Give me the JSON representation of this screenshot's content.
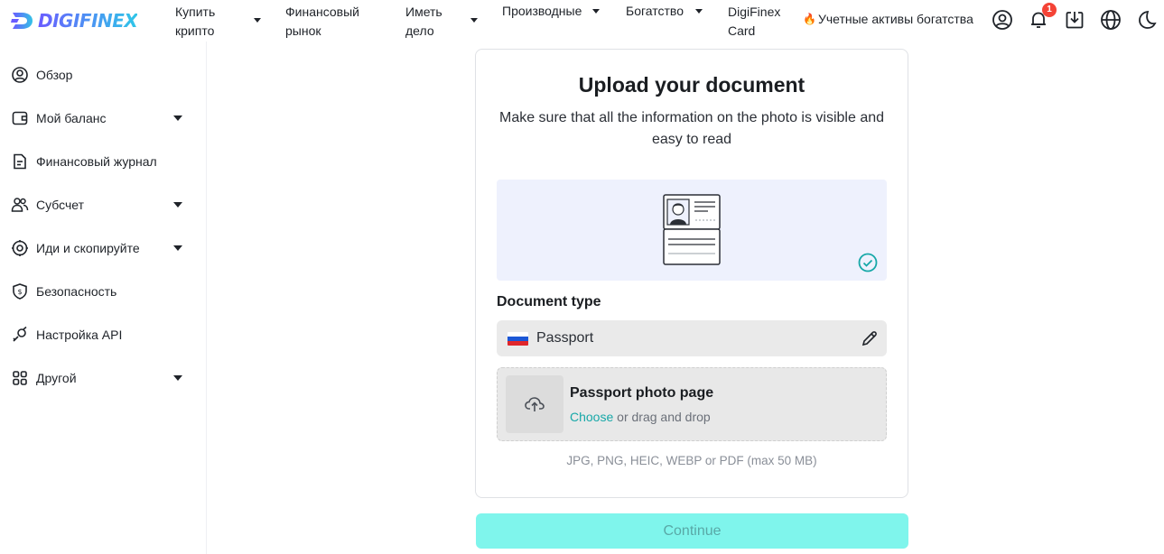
{
  "brand": {
    "name": "DIGIFINEX"
  },
  "nav": {
    "buy_crypto": [
      "Купить",
      "крипто"
    ],
    "markets": [
      "Финансовый",
      "рынок"
    ],
    "earn": [
      "Иметь",
      "дело"
    ],
    "derivatives": "Производные",
    "wealth": "Богатство",
    "card": [
      "DigiFinex",
      "Card"
    ],
    "wealth_accounts": "Учетные активы богатства",
    "notification_count": "1"
  },
  "sidebar": {
    "items": [
      {
        "label": "Обзор",
        "icon": "user-circle-icon",
        "has_submenu": false
      },
      {
        "label": "Мой баланс",
        "icon": "wallet-icon",
        "has_submenu": true
      },
      {
        "label": "Финансовый журнал",
        "icon": "document-icon",
        "has_submenu": false
      },
      {
        "label": "Субсчет",
        "icon": "users-icon",
        "has_submenu": true
      },
      {
        "label": "Иди и скопируйте",
        "icon": "target-icon",
        "has_submenu": true
      },
      {
        "label": "Безопасность",
        "icon": "shield-icon",
        "has_submenu": false
      },
      {
        "label": "Настройка API",
        "icon": "api-key-icon",
        "has_submenu": false
      },
      {
        "label": "Другой",
        "icon": "grid-icon",
        "has_submenu": true
      }
    ]
  },
  "upload": {
    "title": "Upload your document",
    "subtitle": "Make sure that all the information on the photo is visible and easy to read",
    "document_type_label": "Document type",
    "document_type_value": "Passport",
    "file_title": "Passport photo page",
    "choose": "Choose",
    "drag_hint": "or drag and drop",
    "formats": "JPG, PNG, HEIC, WEBP or PDF (max 50 MB)"
  },
  "continue_label": "Continue",
  "colors": {
    "accent": "#17a8a8",
    "continue_bg": "#7ff5ec",
    "badge": "#f44336",
    "illustration_bg": "#eef1fd"
  }
}
